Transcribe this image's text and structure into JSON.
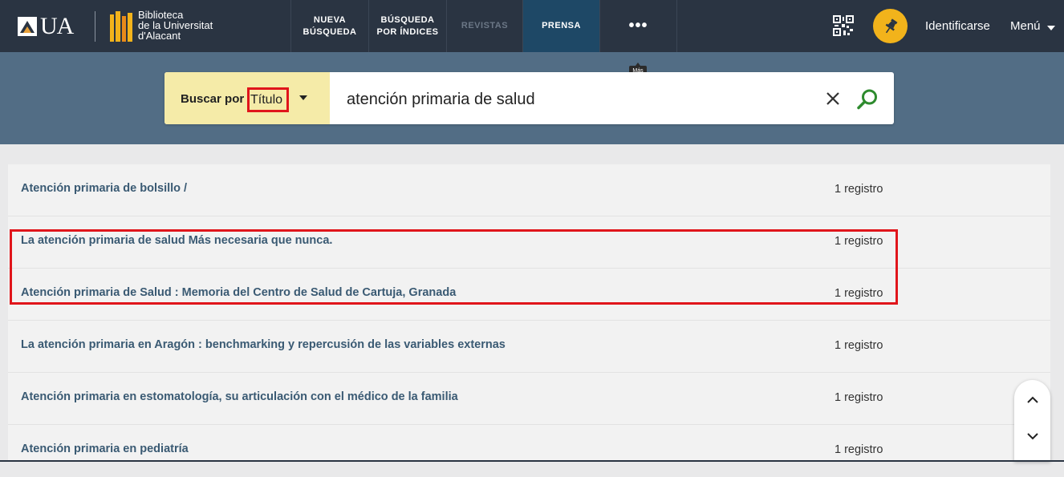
{
  "header": {
    "logo_text": "UA",
    "library_lines": [
      "Biblioteca",
      "de la Universitat",
      "d'Alacant"
    ],
    "nav": [
      {
        "line1": "NUEVA",
        "line2": "BÚSQUEDA"
      },
      {
        "line1": "BÚSQUEDA",
        "line2": "POR ÍNDICES"
      },
      {
        "line1": "REVISTAS",
        "line2": ""
      },
      {
        "line1": "PRENSA",
        "line2": ""
      },
      {
        "line1": "•••",
        "line2": ""
      }
    ],
    "more_tooltip": "Más",
    "login_label": "Identificarse",
    "menu_label": "Menú"
  },
  "search": {
    "by_label": "Buscar por",
    "by_value": "Título",
    "query": "atención primaria de salud"
  },
  "results": [
    {
      "title": "Atención primaria de bolsillo /",
      "count": "1 registro"
    },
    {
      "title": "La atención primaria de salud Más necesaria que nunca.",
      "count": "1 registro"
    },
    {
      "title": "Atención primaria de Salud : Memoria del Centro de Salud de Cartuja, Granada",
      "count": "1 registro"
    },
    {
      "title": "La atención primaria en Aragón : benchmarking y repercusión de las variables externas",
      "count": "1 registro"
    },
    {
      "title": "Atención primaria en estomatología, su articulación con el médico de la familia",
      "count": "1 registro"
    },
    {
      "title": "Atención primaria en pediatría",
      "count": "1 registro"
    }
  ],
  "colors": {
    "header_bg": "#2a3442",
    "search_band": "#526d85",
    "search_by_bg": "#f5eba8",
    "link": "#3a5a73",
    "pin_button": "#f2b31b",
    "highlight": "#e0151b",
    "search_icon": "#2e8b2e"
  }
}
